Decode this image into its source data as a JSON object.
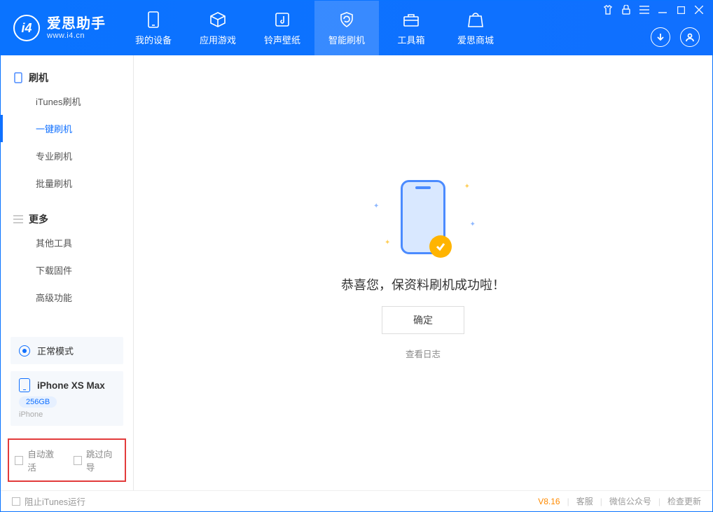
{
  "brand": {
    "title": "爱思助手",
    "subtitle": "www.i4.cn"
  },
  "nav": {
    "device": "我的设备",
    "apps": "应用游戏",
    "rings": "铃声壁纸",
    "flash": "智能刷机",
    "tools": "工具箱",
    "store": "爱思商城"
  },
  "sidebar": {
    "group_flash": "刷机",
    "items_flash": {
      "itunes": "iTunes刷机",
      "oneclick": "一键刷机",
      "pro": "专业刷机",
      "batch": "批量刷机"
    },
    "group_more": "更多",
    "items_more": {
      "other": "其他工具",
      "firmware": "下载固件",
      "advanced": "高级功能"
    }
  },
  "mode": {
    "label": "正常模式"
  },
  "device": {
    "name": "iPhone XS Max",
    "capacity": "256GB",
    "type": "iPhone"
  },
  "options": {
    "auto_activate": "自动激活",
    "skip_guide": "跳过向导"
  },
  "main": {
    "message": "恭喜您，保资料刷机成功啦！",
    "ok": "确定",
    "view_log": "查看日志"
  },
  "footer": {
    "block_itunes": "阻止iTunes运行",
    "version": "V8.16",
    "support": "客服",
    "wechat": "微信公众号",
    "update": "检查更新"
  }
}
